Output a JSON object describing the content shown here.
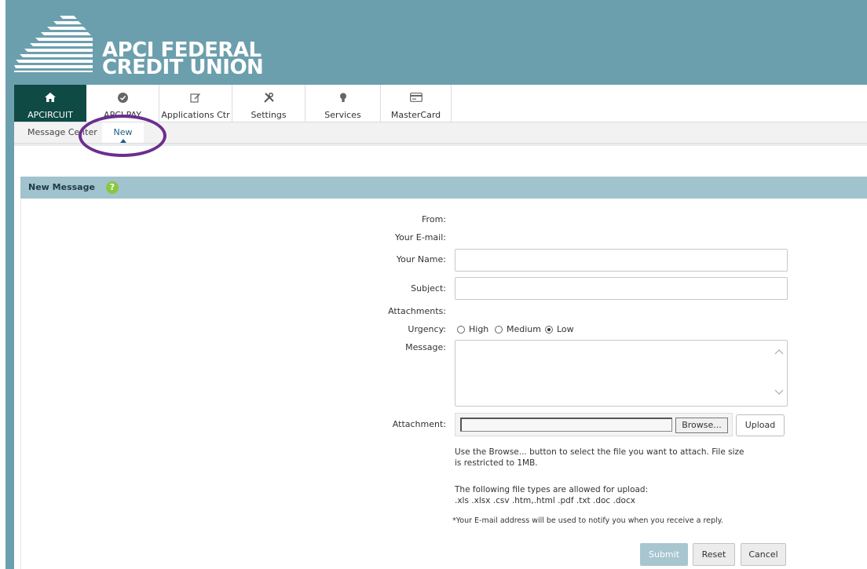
{
  "brand": {
    "line1": "APCI FEDERAL",
    "line2": "CREDIT UNION"
  },
  "nav": {
    "items": [
      {
        "label": "APCIRCUIT",
        "icon": "home-icon"
      },
      {
        "label": "APCI PAY",
        "icon": "check-circle-icon"
      },
      {
        "label": "Applications Ctr",
        "icon": "edit-icon"
      },
      {
        "label": "Settings",
        "icon": "tools-icon"
      },
      {
        "label": "Services",
        "icon": "lightbulb-icon"
      },
      {
        "label": "MasterCard",
        "icon": "credit-card-icon"
      }
    ]
  },
  "subnav": {
    "message_center": "Message Center",
    "new": "New"
  },
  "panel": {
    "title": "New Message",
    "help": "?"
  },
  "form": {
    "from_label": "From:",
    "email_label": "Your E-mail:",
    "name_label": "Your Name:",
    "name_value": "",
    "subject_label": "Subject:",
    "subject_value": "",
    "attachments_label": "Attachments:",
    "urgency_label": "Urgency:",
    "urgency_options": [
      "High",
      "Medium",
      "Low"
    ],
    "urgency_selected": "Low",
    "message_label": "Message:",
    "message_value": "",
    "attachment_label": "Attachment:",
    "browse_label": "Browse...",
    "upload_label": "Upload",
    "help_line1": "Use the Browse... button to select the file you want to attach. File size",
    "help_line2": "is restricted to 1MB.",
    "types_line1": "The following file types are allowed for upload:",
    "types_line2": ".xls .xlsx .csv .htm,.html .pdf .txt .doc .docx",
    "footnote": "*Your E-mail address will be used to notify you when you receive a reply.",
    "submit_label": "Submit",
    "reset_label": "Reset",
    "cancel_label": "Cancel"
  },
  "colors": {
    "header": "#6c9fad",
    "nav_active": "#0f4a44",
    "panel_header": "#a0c3cd",
    "annotation_oval": "#6c2e8f",
    "submit": "#a7c6cf"
  }
}
